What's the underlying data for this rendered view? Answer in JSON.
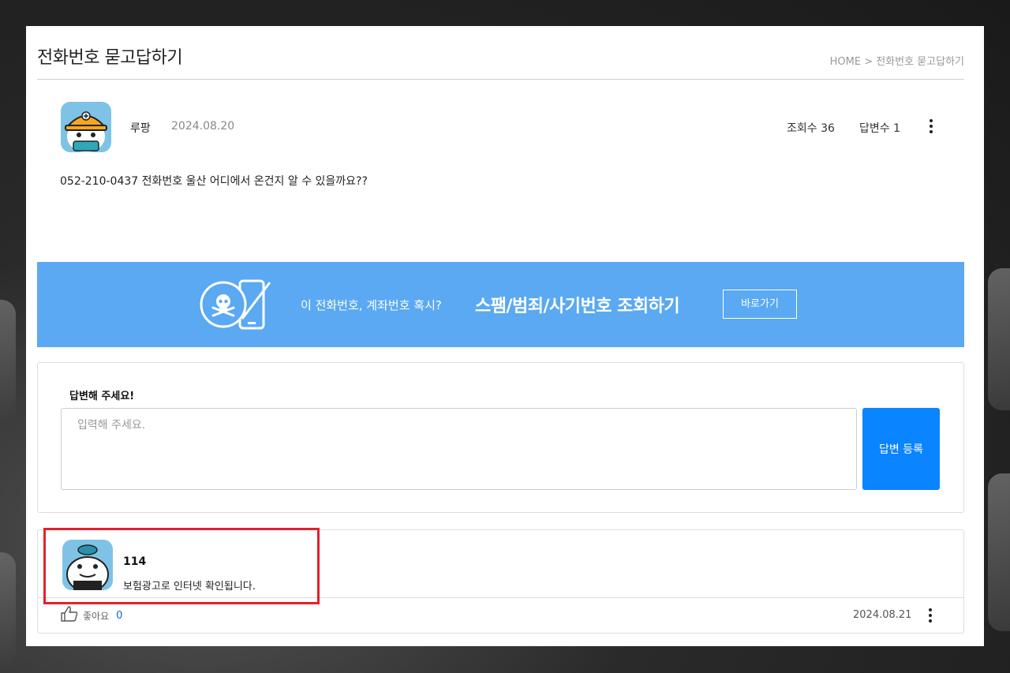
{
  "page": {
    "title": "전화번호 묻고답하기",
    "breadcrumb": "HOME > 전화번호 묻고답하기"
  },
  "post": {
    "author": "루팡",
    "date": "2024.08.20",
    "views": "조회수 36",
    "answers": "답변수 1",
    "question": "052-210-0437 전화번호 울산 어디에서 온건지 알 수 있을까요??"
  },
  "banner": {
    "small_text": "이 전화번호, 계좌번호 혹시?",
    "big_text": "스팸/범죄/사기번호 조회하기",
    "button_label": "바로가기",
    "color": "#5aa9f2"
  },
  "answer_form": {
    "title": "답변해 주세요!",
    "placeholder": "입력해 주세요.",
    "submit_label": "답변 등록",
    "submit_color": "#0a84ff"
  },
  "reply": {
    "author": "114",
    "text": "보험광고로 인터넷 확인됩니다.",
    "like_label": "좋아요",
    "like_count": "0",
    "date": "2024.08.21",
    "highlight_color": "#e5202d"
  },
  "icons": [
    "more-vert-icon",
    "skull-phone-icon",
    "thumbs-up-icon"
  ]
}
